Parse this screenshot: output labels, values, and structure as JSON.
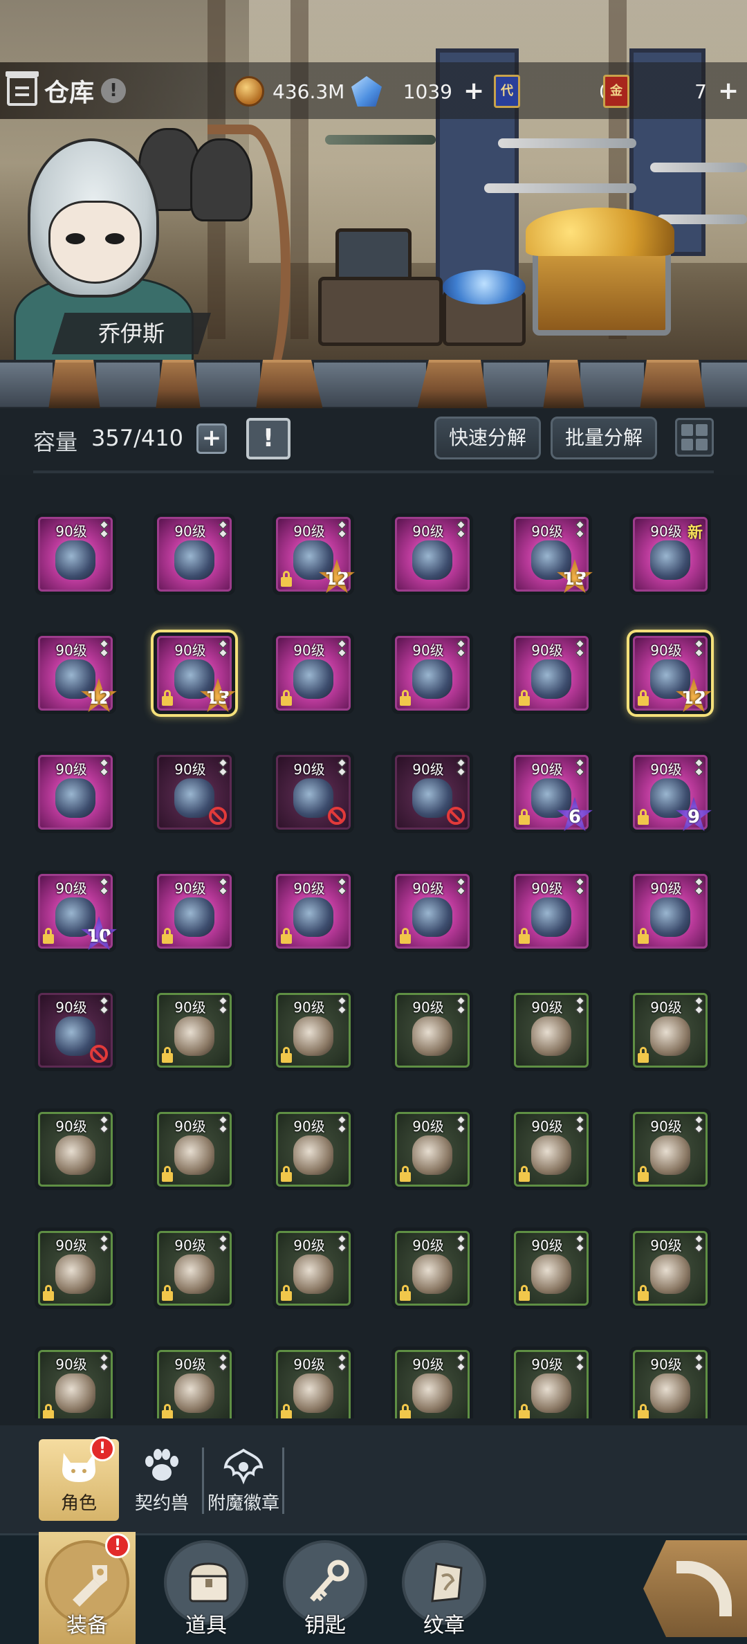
{
  "header": {
    "title": "仓库",
    "info_icon": "!",
    "gold": "436.3M",
    "crystal": "1039",
    "card_blue_symbol": "代",
    "card_blue_value": "0",
    "card_red_symbol": "金",
    "card_red_value": "7",
    "plus": "+"
  },
  "character": {
    "name": "乔伊斯"
  },
  "capacity": {
    "label": "容量",
    "value": "357/410",
    "plus": "+",
    "calendar_mark": "!",
    "quick_decompose": "快速分解",
    "batch_decompose": "批量分解"
  },
  "item_level_label": "90级",
  "new_tag": "新",
  "items": [
    {
      "r": "purple",
      "lock": false,
      "star": "",
      "new": false
    },
    {
      "r": "purple",
      "lock": false,
      "star": "",
      "new": false
    },
    {
      "r": "purple",
      "lock": true,
      "star": "12",
      "new": false
    },
    {
      "r": "purple",
      "lock": false,
      "star": "",
      "new": false
    },
    {
      "r": "purple",
      "lock": false,
      "star": "13",
      "new": false
    },
    {
      "r": "purple",
      "lock": false,
      "star": "",
      "new": true
    },
    {
      "r": "purple",
      "lock": false,
      "star": "12",
      "new": false
    },
    {
      "r": "purple",
      "lock": true,
      "star": "13",
      "new": false,
      "sel": true
    },
    {
      "r": "purple",
      "lock": true,
      "star": "",
      "new": false
    },
    {
      "r": "purple",
      "lock": true,
      "star": "",
      "new": false
    },
    {
      "r": "purple",
      "lock": true,
      "star": "",
      "new": false
    },
    {
      "r": "purple",
      "lock": true,
      "star": "12",
      "new": false,
      "sel": true
    },
    {
      "r": "purple",
      "lock": false,
      "star": "",
      "new": false
    },
    {
      "r": "purple",
      "dim": true,
      "ban": true
    },
    {
      "r": "purple",
      "dim": true,
      "ban": true
    },
    {
      "r": "purple",
      "dim": true,
      "ban": true
    },
    {
      "r": "purple",
      "lock": true,
      "star": "6",
      "violet": true
    },
    {
      "r": "purple",
      "lock": true,
      "star": "9",
      "violet": true
    },
    {
      "r": "purple",
      "lock": true,
      "star": "10",
      "violet": true
    },
    {
      "r": "purple",
      "lock": true
    },
    {
      "r": "purple",
      "lock": true
    },
    {
      "r": "purple",
      "lock": true
    },
    {
      "r": "purple",
      "lock": true
    },
    {
      "r": "purple",
      "lock": true
    },
    {
      "r": "purple",
      "dim": true,
      "ban": true
    },
    {
      "r": "green",
      "lock": true
    },
    {
      "r": "green",
      "lock": true
    },
    {
      "r": "green",
      "lock": false
    },
    {
      "r": "green",
      "lock": false
    },
    {
      "r": "green",
      "lock": true
    },
    {
      "r": "green",
      "lock": false
    },
    {
      "r": "green",
      "lock": true
    },
    {
      "r": "green",
      "lock": true
    },
    {
      "r": "green",
      "lock": true
    },
    {
      "r": "green",
      "lock": true
    },
    {
      "r": "green",
      "lock": true
    },
    {
      "r": "green",
      "lock": true
    },
    {
      "r": "green",
      "lock": true
    },
    {
      "r": "green",
      "lock": true
    },
    {
      "r": "green",
      "lock": true
    },
    {
      "r": "green",
      "lock": true
    },
    {
      "r": "green",
      "lock": true
    },
    {
      "r": "green",
      "lock": true
    },
    {
      "r": "green",
      "lock": true
    },
    {
      "r": "green",
      "lock": true
    },
    {
      "r": "green",
      "lock": true
    },
    {
      "r": "green",
      "lock": true
    },
    {
      "r": "green",
      "lock": true
    }
  ],
  "subtabs": [
    {
      "label": "角色",
      "active": true,
      "badge": "!",
      "icon": "cat-face-icon"
    },
    {
      "label": "契约兽",
      "active": false,
      "icon": "paw-icon"
    },
    {
      "label": "附魔徽章",
      "active": false,
      "icon": "enchant-emblem-icon"
    }
  ],
  "nav": [
    {
      "label": "装备",
      "active": true,
      "badge": "!",
      "icon": "equipment-icon"
    },
    {
      "label": "道具",
      "active": false,
      "icon": "chest-icon"
    },
    {
      "label": "钥匙",
      "active": false,
      "icon": "key-icon"
    },
    {
      "label": "纹章",
      "active": false,
      "icon": "crest-icon"
    }
  ],
  "colors": {
    "rare_purple": "#b93a9a",
    "uncommon_green": "#5f8f44",
    "selected_glow": "#f4e07a",
    "badge_red": "#e22a2a"
  }
}
